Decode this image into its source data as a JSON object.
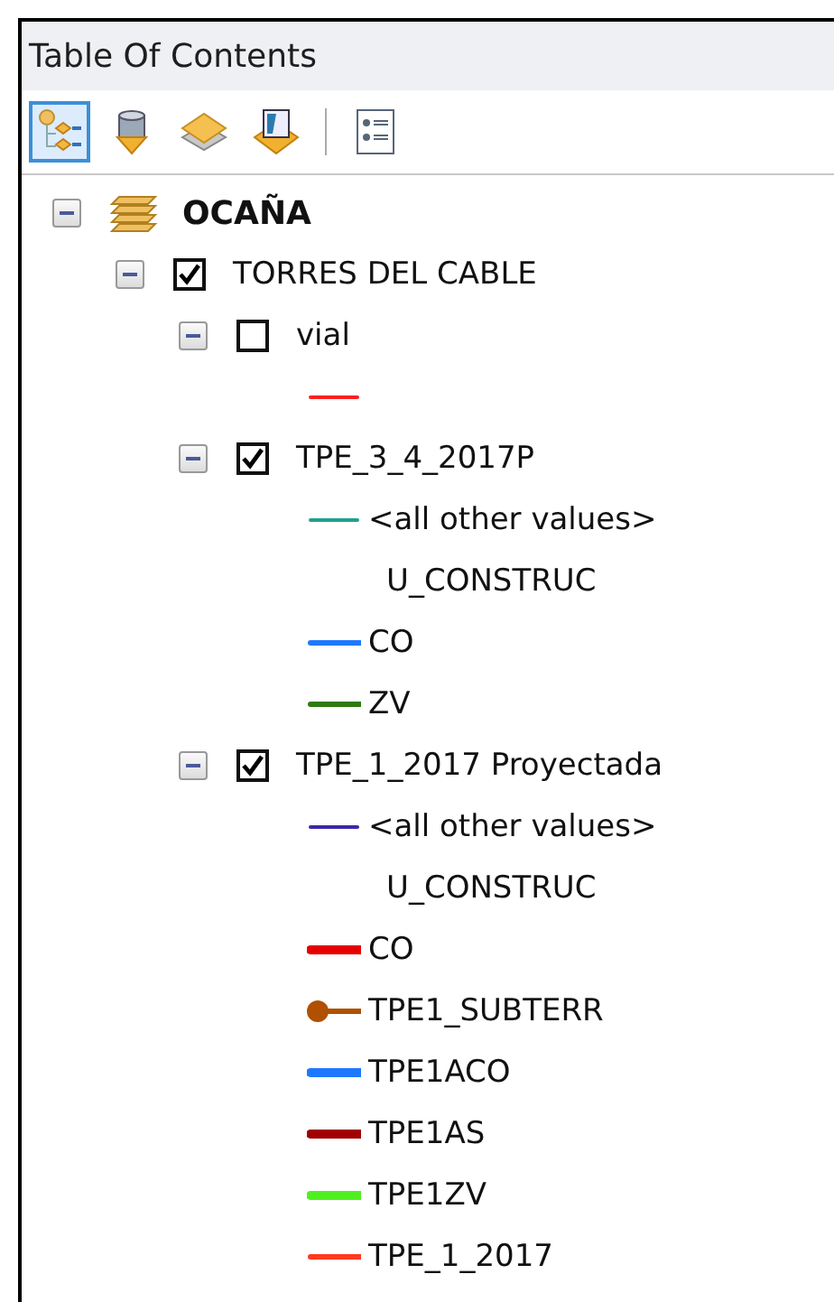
{
  "panel": {
    "title": "Table Of Contents"
  },
  "toolbar_groups": [
    [
      {
        "kind": "drawing-order",
        "selected": true
      },
      {
        "kind": "source",
        "selected": false
      },
      {
        "kind": "visibility",
        "selected": false
      },
      {
        "kind": "selection",
        "selected": false
      }
    ],
    [
      {
        "kind": "options",
        "selected": false
      }
    ]
  ],
  "tree": [
    {
      "kind": "group",
      "name": "OCAÑA",
      "expanded": true,
      "children": [
        {
          "kind": "layer",
          "name": "TORRES DEL CABLE",
          "checked": true,
          "expanded": true,
          "children": [
            {
              "kind": "layer",
              "name": "vial",
              "checked": false,
              "expanded": true,
              "legend": [
                {
                  "kind": "thin-line",
                  "color": "#ff2020"
                }
              ]
            },
            {
              "kind": "layer",
              "name": "TPE_3_4_2017P",
              "checked": true,
              "expanded": true,
              "legend": [
                {
                  "kind": "thin-line",
                  "color": "#20a090",
                  "label": "<all other values>"
                },
                {
                  "kind": "heading",
                  "label": "U_CONSTRUC"
                },
                {
                  "kind": "line",
                  "color": "#1e78ff",
                  "label": "CO"
                },
                {
                  "kind": "line",
                  "color": "#2f7a10",
                  "label": "ZV"
                }
              ]
            },
            {
              "kind": "layer",
              "name": "TPE_1_2017 Proyectada",
              "checked": true,
              "expanded": true,
              "legend": [
                {
                  "kind": "thin-line",
                  "color": "#3a2aa8",
                  "label": "<all other values>"
                },
                {
                  "kind": "heading",
                  "label": "U_CONSTRUC"
                },
                {
                  "kind": "heavy-line",
                  "color": "#e60000",
                  "label": "CO"
                },
                {
                  "kind": "dot-line",
                  "color": "#b05000",
                  "label": "TPE1_SUBTERR"
                },
                {
                  "kind": "heavy-line",
                  "color": "#1e78ff",
                  "label": "TPE1ACO"
                },
                {
                  "kind": "heavy-line",
                  "color": "#a00000",
                  "label": "TPE1AS"
                },
                {
                  "kind": "heavy-line",
                  "color": "#50f020",
                  "label": "TPE1ZV"
                },
                {
                  "kind": "line",
                  "color": "#ff3a20",
                  "label": "TPE_1_2017"
                }
              ]
            }
          ]
        }
      ]
    }
  ]
}
